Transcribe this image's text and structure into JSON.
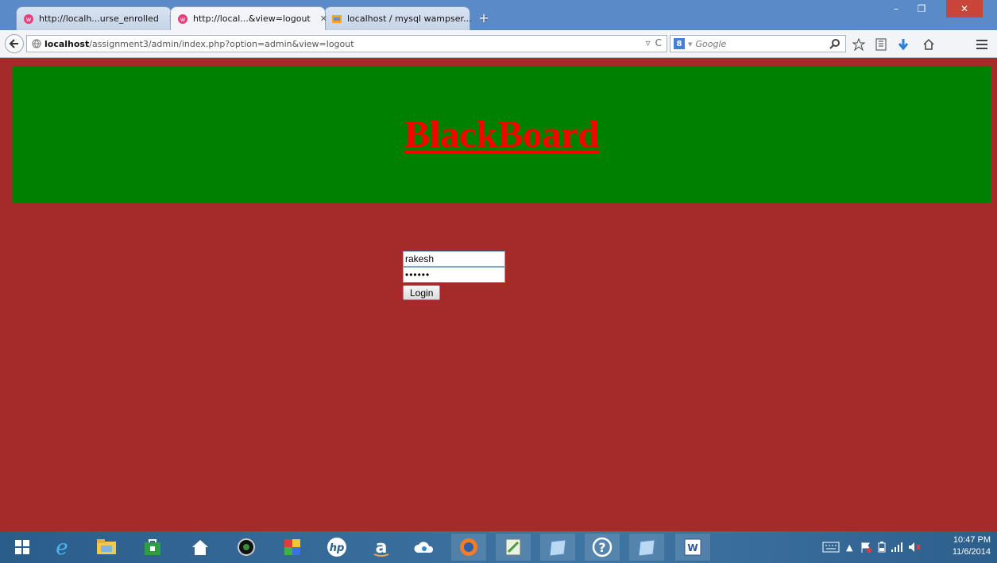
{
  "browser": {
    "tabs": [
      {
        "title": "http://localh...urse_enrolled",
        "active": false,
        "icon": "wamp-icon"
      },
      {
        "title": "http://local...&view=logout",
        "active": true,
        "icon": "wamp-icon"
      },
      {
        "title": "localhost / mysql wampser...",
        "active": false,
        "icon": "phpmyadmin-icon"
      }
    ],
    "url_host": "localhost",
    "url_path": "/assignment3/admin/index.php?option=admin&view=logout",
    "search_placeholder": "Google",
    "window_buttons": {
      "minimize": "–",
      "maximize": "❐",
      "close": "✕"
    }
  },
  "page": {
    "header_title": "BlackBoard",
    "login": {
      "username_value": "rakesh",
      "password_value": "••••••",
      "button_label": "Login"
    },
    "colors": {
      "background": "#a52a2a",
      "header": "#008000",
      "title": "#ff0000"
    }
  },
  "taskbar": {
    "apps": [
      "windows-start-icon",
      "internet-explorer-icon",
      "file-explorer-icon",
      "store-icon",
      "home-icon",
      "camera-app-icon",
      "puzzle-app-icon",
      "hp-icon",
      "amazon-icon",
      "cloud-app-icon",
      "firefox-icon",
      "notepad-app-icon",
      "window-app-icon",
      "help-icon",
      "window-app-icon-2",
      "word-icon"
    ],
    "time": "10:47 PM",
    "date": "11/6/2014"
  }
}
